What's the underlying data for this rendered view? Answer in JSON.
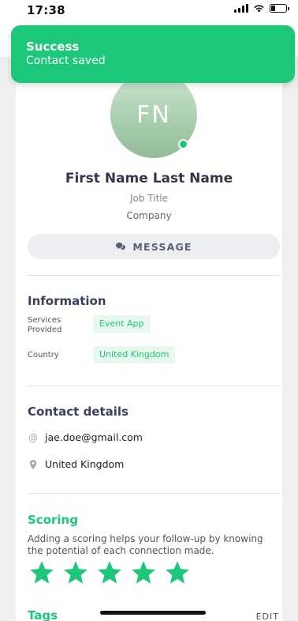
{
  "status_bar": {
    "time": "17:38"
  },
  "toast": {
    "title": "Success",
    "message": "Contact saved"
  },
  "profile": {
    "initials": "FN",
    "name": "First Name Last Name",
    "job_title": "Job Title",
    "company": "Company"
  },
  "actions": {
    "message_label": "MESSAGE"
  },
  "information": {
    "heading": "Information",
    "fields": [
      {
        "label": "Services Provided",
        "value": "Event App"
      },
      {
        "label": "Country",
        "value": "United Kingdom"
      }
    ]
  },
  "contact_details": {
    "heading": "Contact details",
    "email": "jae.doe@gmail.com",
    "location": "United Kingdom"
  },
  "scoring": {
    "heading": "Scoring",
    "description": "Adding a scoring helps your follow-up by knowing the potential of each connection made.",
    "rating": 5,
    "max_rating": 5
  },
  "tags": {
    "heading": "Tags",
    "edit_label": "EDIT"
  },
  "colors": {
    "accent": "#1cc77a",
    "text_dark": "#3a3f5c",
    "chip_bg": "#e8f8ef"
  }
}
